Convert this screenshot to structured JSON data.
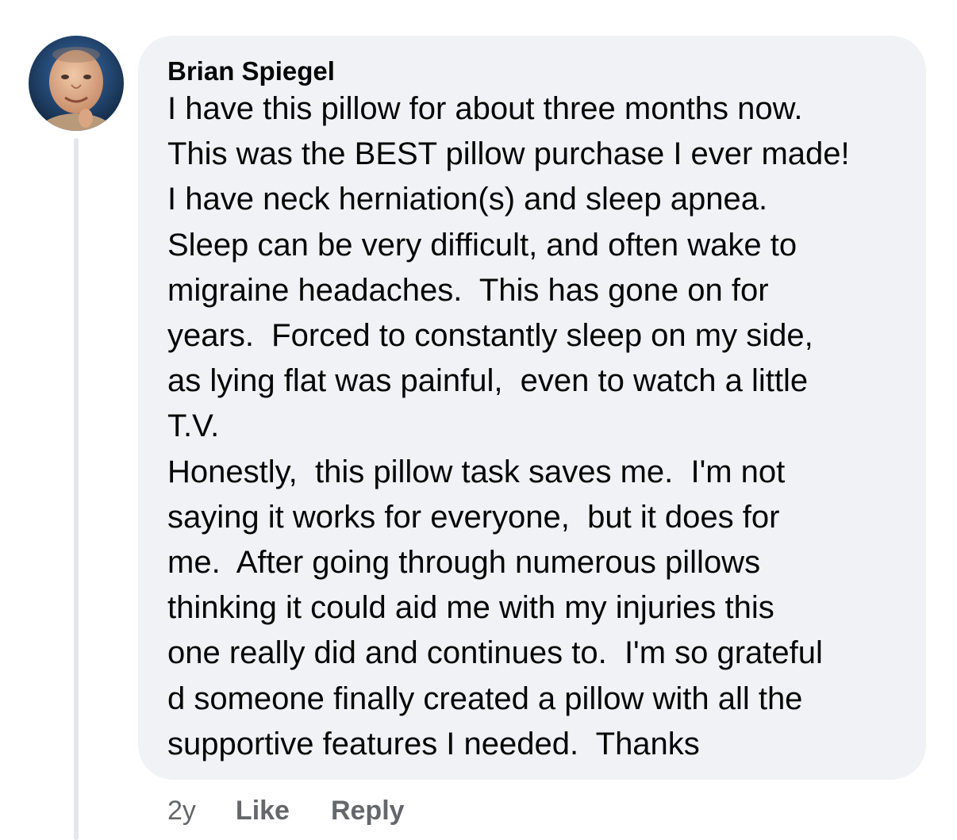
{
  "comment": {
    "author": "Brian Spiegel",
    "avatar_alt": "Brian Spiegel profile photo",
    "lines": [
      "I have this pillow for about three months now.",
      "This was the BEST pillow purchase I ever made!",
      "I have neck herniation(s) and sleep apnea.",
      "Sleep can be very difficult, and often wake to",
      "migraine headaches.  This has gone on for",
      "years.  Forced to constantly sleep on my side,",
      "as lying flat was painful,  even to watch a little",
      "T.V.",
      "Honestly,  this pillow task saves me.  I'm not",
      "saying it works for everyone,  but it does for",
      "me.  After going through numerous pillows",
      "thinking it could aid me with my injuries this",
      "one really did and continues to.  I'm so grateful",
      "d someone finally created a pillow with all the",
      "supportive features I needed.  Thanks"
    ]
  },
  "actions": {
    "timestamp": "2y",
    "like_label": "Like",
    "reply_label": "Reply"
  },
  "colors": {
    "bubble_background": "#f0f2f5",
    "thread_line": "#e4e6eb",
    "secondary_text": "#65676b",
    "primary_text": "#050505"
  }
}
